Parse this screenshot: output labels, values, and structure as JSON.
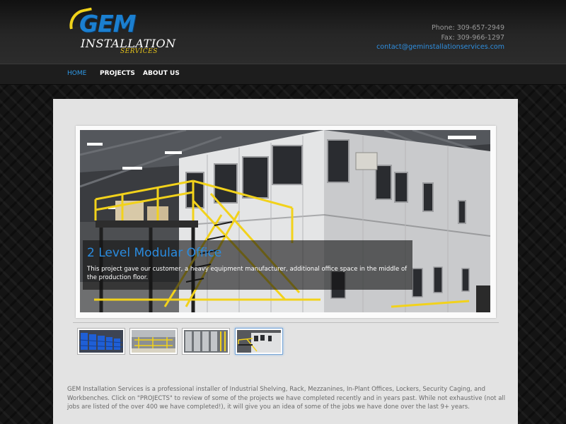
{
  "brand": {
    "logo_main": "GEM",
    "logo_sub": "INSTALLATION",
    "logo_tag": "SERVICES"
  },
  "contact": {
    "phone": "Phone: 309-657-2949",
    "fax": "Fax: 309-966-1297",
    "email": "contact@geminstallationservices.com"
  },
  "nav": {
    "items": [
      {
        "label": "HOME",
        "active": true
      },
      {
        "label": "PROJECTS",
        "active": false
      },
      {
        "label": "ABOUT US",
        "active": false
      }
    ]
  },
  "slider": {
    "title": "2 Level Modular Office",
    "text": "This project gave our customer, a heavy equipment manufacturer, additional office space in the middle of the production floor.",
    "active_index": 3,
    "thumb_count": 4
  },
  "intro": {
    "text": "GEM Installation Services is a professional installer of Industrial Shelving, Rack, Mezzanines, In-Plant Offices, Lockers, Security Caging, and Workbenches.  Click on \"PROJECTS\" to review of some of the projects we have completed recently and in years past.  While not exhaustive (not all jobs are listed of the over 400 we have completed!), it will give you an idea of some of the jobs we have done over the last 9+ years."
  },
  "colors": {
    "accent_blue": "#2f8fe0",
    "logo_yellow": "#f0d21a",
    "safety_yellow": "#f2d21b",
    "content_bg": "#e3e3e3"
  }
}
